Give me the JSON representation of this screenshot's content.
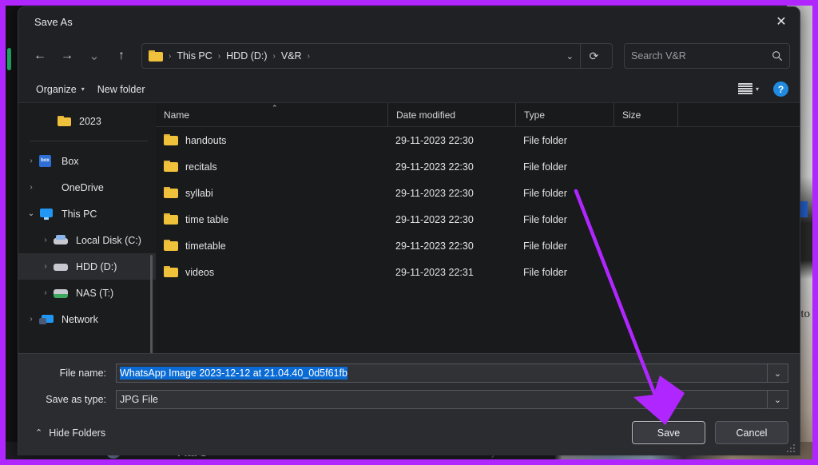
{
  "window": {
    "title": "Save As",
    "close_icon": "close-icon"
  },
  "nav": {
    "back_icon": "←",
    "forward_icon": "→",
    "recent_icon": "⌄",
    "up_icon": "↑",
    "refresh_icon": "⟳",
    "address_chevron": "⌄",
    "breadcrumbs": [
      "This PC",
      "HDD (D:)",
      "V&R"
    ],
    "separator": "›"
  },
  "search": {
    "placeholder": "Search V&R",
    "value": "",
    "icon": "search-icon"
  },
  "toolbar": {
    "organize_label": "Organize",
    "organize_caret": "▾",
    "new_folder_label": "New folder",
    "view_icon": "list-view-icon",
    "view_caret": "▾",
    "help_label": "?"
  },
  "sidebar": {
    "items": [
      {
        "label": "2023",
        "icon": "folder-icon",
        "chevron": "",
        "indent": 22,
        "selected": false
      },
      {
        "label": "Box",
        "icon": "box-icon",
        "chevron": "›",
        "indent": 0,
        "selected": false
      },
      {
        "label": "OneDrive",
        "icon": "onedrive-icon",
        "chevron": "›",
        "indent": 0,
        "selected": false
      },
      {
        "label": "This PC",
        "icon": "this-pc-icon",
        "chevron": "⌄",
        "indent": 0,
        "selected": false
      },
      {
        "label": "Local Disk (C:)",
        "icon": "local-disk-icon",
        "chevron": "›",
        "indent": 18,
        "selected": false
      },
      {
        "label": "HDD (D:)",
        "icon": "hard-drive-icon",
        "chevron": "›",
        "indent": 18,
        "selected": true
      },
      {
        "label": "NAS (T:)",
        "icon": "nas-drive-icon",
        "chevron": "›",
        "indent": 18,
        "selected": false
      },
      {
        "label": "Network",
        "icon": "network-icon",
        "chevron": "›",
        "indent": 0,
        "selected": false
      }
    ]
  },
  "filelist": {
    "columns": [
      "Name",
      "Date modified",
      "Type",
      "Size"
    ],
    "sort_column": "Name",
    "sort_arrow": "⌃",
    "rows": [
      {
        "name": "handouts",
        "date": "29-11-2023 22:30",
        "type": "File folder",
        "size": ""
      },
      {
        "name": "recitals",
        "date": "29-11-2023 22:30",
        "type": "File folder",
        "size": ""
      },
      {
        "name": "syllabi",
        "date": "29-11-2023 22:30",
        "type": "File folder",
        "size": ""
      },
      {
        "name": "time table",
        "date": "29-11-2023 22:30",
        "type": "File folder",
        "size": ""
      },
      {
        "name": "timetable",
        "date": "29-11-2023 22:30",
        "type": "File folder",
        "size": ""
      },
      {
        "name": "videos",
        "date": "29-11-2023 22:31",
        "type": "File folder",
        "size": ""
      }
    ]
  },
  "form": {
    "file_name_label": "File name:",
    "file_name_value": "WhatsApp Image 2023-12-12 at 21.04.40_0d5f61fb",
    "save_as_type_label": "Save as type:",
    "save_as_type_value": "JPG File",
    "dropdown_chevron": "⌄"
  },
  "footer": {
    "hide_folders_label": "Hide Folders",
    "hide_folders_chevron": "⌃",
    "save_label": "Save",
    "cancel_label": "Cancel"
  },
  "background": {
    "contact_name": "Pita G",
    "timestamp": "Yesterday",
    "overlap_text": "to"
  },
  "annotation": {
    "arrow_color": "#b026ff",
    "frame_color": "#b026ff",
    "points_to": "save-button"
  }
}
